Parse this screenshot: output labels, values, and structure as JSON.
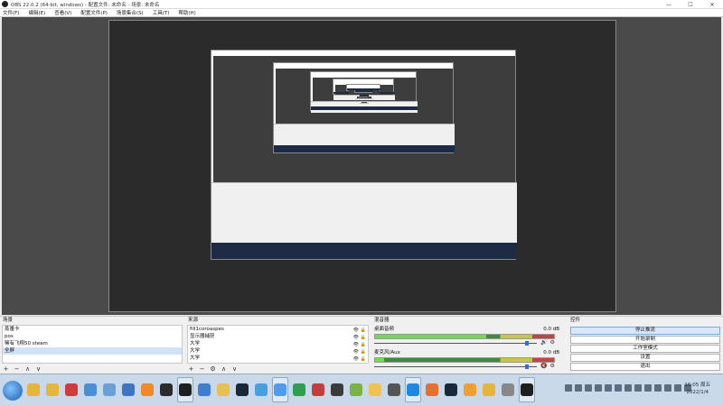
{
  "window": {
    "title": "OBS 22.0.2 (64-bit, windows) - 配置文件: 未命名 - 场景: 未命名",
    "minimize": "—",
    "maximize": "☐",
    "close": "✕"
  },
  "menu": [
    "文件(F)",
    "编辑(E)",
    "查看(V)",
    "配置文件(P)",
    "场景集合(S)",
    "工具(T)",
    "帮助(H)"
  ],
  "scenes": {
    "title": "场景",
    "items": [
      "蒸番卡",
      "pos",
      "稀有飞翔50 steam",
      "全屏"
    ],
    "selected_index": 3
  },
  "sources": {
    "title": "来源",
    "items": [
      "fill1coroaspes",
      "显示器捕获",
      "大学",
      "大学",
      "大学"
    ]
  },
  "mixer": {
    "title": "混音器",
    "tracks": [
      {
        "name": "桌面音频",
        "db": "0.0 dB",
        "level": 0.62,
        "volume": 0.95
      },
      {
        "name": "麦克风/Aux",
        "db": "0.0 dB",
        "level": 0.05,
        "volume": 0.95
      }
    ]
  },
  "controls": {
    "title": "控件",
    "buttons": [
      "停止推流",
      "开始录制",
      "工作室模式",
      "设置",
      "退出"
    ]
  },
  "toolbar": {
    "add": "+",
    "remove": "−",
    "gear": "⚙",
    "up": "∧",
    "down": "∨"
  },
  "taskbar": {
    "icons": [
      "folder-icon",
      "folder-icon",
      "netease-music-icon",
      "chrome-icon",
      "notepad-icon",
      "document-icon",
      "app-icon",
      "chat-icon",
      "obs-icon",
      "ie-icon",
      "explorer-icon",
      "steam-icon",
      "app-icon",
      "cloud-icon",
      "video-icon",
      "mail-icon",
      "gamepad-icon",
      "game-icon",
      "app-icon",
      "app-icon",
      "qq-icon",
      "chat-icon",
      "steam-icon",
      "app-icon",
      "folder-icon",
      "app-icon",
      "obs-icon"
    ],
    "time": "16:05 周五",
    "date": "2022/1/4"
  },
  "colors": {
    "accent": "#2f6fdc",
    "selected": "#cfe3fa",
    "meter_green": "#6ddf4a",
    "taskbar": "#c9d9e9"
  }
}
